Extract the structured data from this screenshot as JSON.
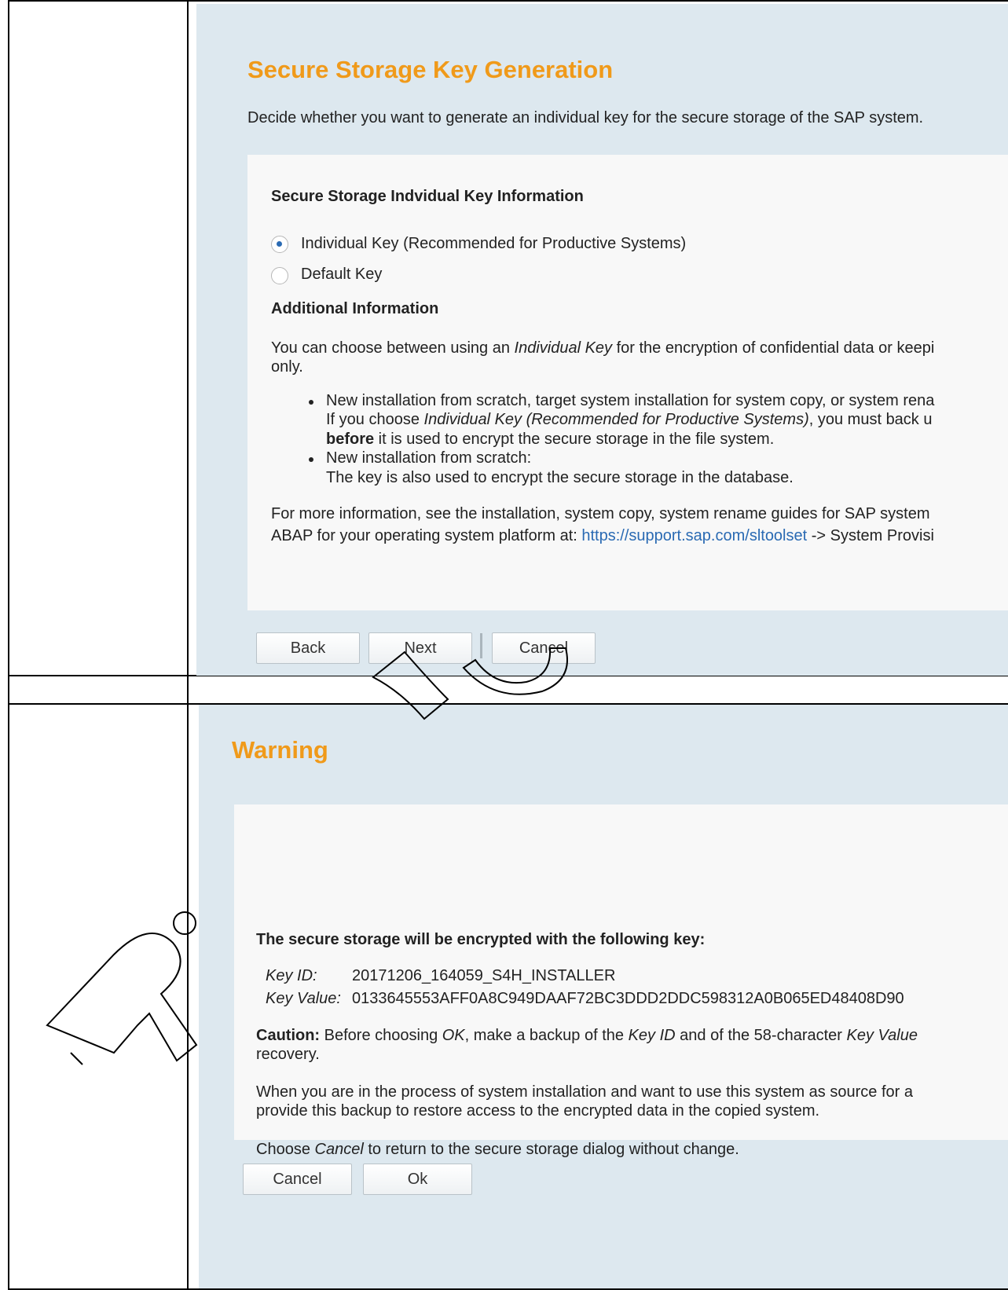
{
  "screen1": {
    "title": "Secure Storage Key Generation",
    "intro": "Decide whether you want to generate an individual key for the secure storage of the SAP system.",
    "section_title": "Secure Storage Indvidual Key Information",
    "options": [
      {
        "label": "Individual Key (Recommended for Productive Systems)",
        "selected": true
      },
      {
        "label": "Default Key",
        "selected": false
      }
    ],
    "additional_title": "Additional Information",
    "para1_before": "You can choose between using an ",
    "para1_italic": "Individual Key",
    "para1_after": " for the encryption of confidential data or keepi",
    "para1_line2": "only.",
    "bullet1_line1": "New installation from scratch, target system installation for system copy, or system rena",
    "bullet1_line2_before": "If you choose ",
    "bullet1_line2_italic": "Individual Key (Recommended for Productive Systems)",
    "bullet1_line2_after": ", you must back u",
    "bullet1_line3_bold": "before",
    "bullet1_line3_after": " it is used to encrypt the secure storage in the file system.",
    "bullet2_line1": "New installation from scratch:",
    "bullet2_line2": "The key is also used to encrypt the secure storage in the database.",
    "more_info_line1": "For more information, see the installation, system copy, system rename guides for SAP system",
    "more_info_line2_before": "ABAP for your operating system platform at: ",
    "more_info_link": "https://support.sap.com/sltoolset",
    "more_info_line2_after": " -> System Provisi",
    "buttons": {
      "back": "Back",
      "next": "Next",
      "cancel": "Cancel"
    }
  },
  "screen2": {
    "title": "Warning",
    "heading": "The secure storage will be encrypted with the following key:",
    "key_id_label": "Key ID:",
    "key_id_value": "20171206_164059_S4H_INSTALLER",
    "key_value_label": "Key Value:",
    "key_value_value": "0133645553AFF0A8C949DAAF72BC3DDD2DDC598312A0B065ED48408D90",
    "caution_bold": "Caution:",
    "caution_1": " Before choosing ",
    "caution_ok": "OK",
    "caution_2": ", make a backup of the ",
    "caution_keyid": "Key ID",
    "caution_3": " and of the 58-character ",
    "caution_keyvalue": "Key Value",
    "caution_line2": "recovery.",
    "para2_line1": "When you are in the process of system installation and want to use this system as source for a",
    "para2_line2": "provide this backup to restore access to the encrypted data in the copied system.",
    "para3_before": "Choose ",
    "para3_italic": "Cancel",
    "para3_after": " to return to the secure storage dialog without change.",
    "buttons": {
      "cancel": "Cancel",
      "ok": "Ok"
    }
  },
  "colors": {
    "title": "#f09a1a",
    "panel_bg": "#dde8ef",
    "card_bg": "#f8f8f8",
    "link": "#2a6ab3",
    "radio_dot": "#2a6ab3"
  }
}
